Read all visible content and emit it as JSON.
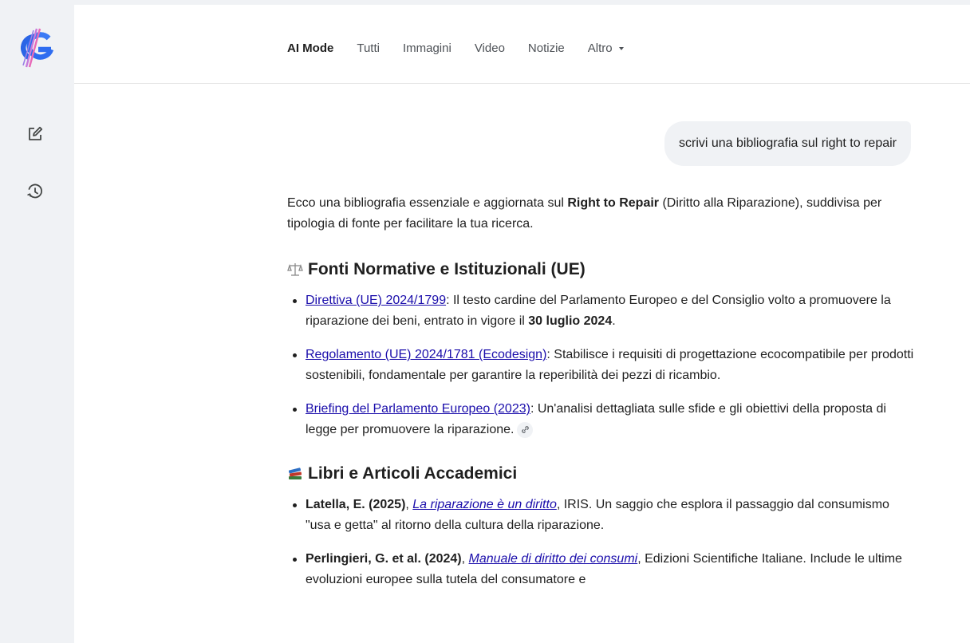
{
  "tabs": [
    {
      "label": "AI Mode"
    },
    {
      "label": "Tutti"
    },
    {
      "label": "Immagini"
    },
    {
      "label": "Video"
    },
    {
      "label": "Notizie"
    },
    {
      "label": "Altro"
    }
  ],
  "query": "scrivi una bibliografia sul right to repair",
  "answer": {
    "intro": {
      "t1": "Ecco una bibliografia essenziale e aggiornata sul ",
      "b1": "Right to Repair",
      "t2": " (Diritto alla Riparazione), suddivisa per tipologia di fonte per facilitare la tua ricerca."
    },
    "sections": [
      {
        "title": "Fonti Normative e Istituzionali (UE)",
        "items": [
          {
            "link": "Direttiva (UE) 2024/1799",
            "t1": ": Il testo cardine del Parlamento Europeo e del Consiglio volto a promuovere la riparazione dei beni, entrato in vigore il ",
            "bold": "30 luglio 2024",
            "t2": "."
          },
          {
            "link": "Regolamento (UE) 2024/1781 (Ecodesign)",
            "t1": ": Stabilisce i requisiti di progettazione ecocompatibile per prodotti sostenibili, fondamentale per garantire la reperibilità dei pezzi di ricambio."
          },
          {
            "link": "Briefing del Parlamento Europeo (2023)",
            "t1": ": Un'analisi dettagliata sulle sfide e gli obiettivi della proposta di legge per promuovere la riparazione."
          }
        ]
      },
      {
        "title": "Libri e Articoli Accademici",
        "items": [
          {
            "author": "Latella, E. (2025)",
            "sep": ", ",
            "link": "La riparazione è un diritto",
            "t1": ", IRIS. Un saggio che esplora il passaggio dal consumismo \"usa e getta\" al ritorno della cultura della riparazione."
          },
          {
            "author": "Perlingieri, G. et al. (2024)",
            "sep": ", ",
            "link": "Manuale di diritto dei consumi",
            "t1": ", Edizioni Scientifiche Italiane. Include le ultime evoluzioni europee sulla tutela del consumatore e"
          }
        ]
      }
    ]
  },
  "colors": {
    "link": "#1a0dab",
    "sidebar_bg": "#f0f2f5",
    "bubble_bg": "#f0f2f5"
  },
  "icons": [
    "google-g-logo-icon",
    "new-chat-icon",
    "history-icon",
    "scales-emoji-icon",
    "books-emoji-icon",
    "link-icon",
    "dropdown-caret-icon"
  ]
}
